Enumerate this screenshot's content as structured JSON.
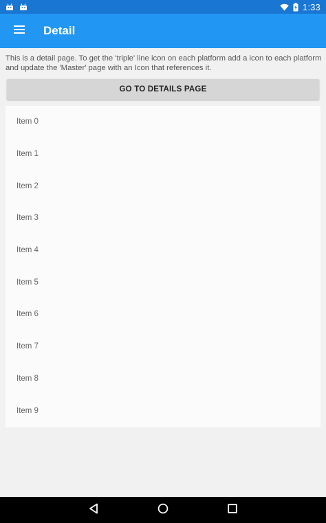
{
  "status_bar": {
    "time": "1:33",
    "left_icons": [
      "android-icon",
      "android-icon"
    ],
    "right_icons": [
      "wifi-icon",
      "battery-charging-icon"
    ]
  },
  "toolbar": {
    "title": "Detail",
    "menu_icon": "hamburger-menu-icon",
    "background": "#2196f3"
  },
  "page": {
    "description": "This is a detail page. To get the 'triple' line icon on each platform add a icon to each platform and update the 'Master' page with an Icon that references it.",
    "button_label": "GO TO DETAILS PAGE"
  },
  "list": {
    "items": [
      "Item 0",
      "Item 1",
      "Item 2",
      "Item 3",
      "Item 4",
      "Item 5",
      "Item 6",
      "Item 7",
      "Item 8",
      "Item 9"
    ]
  },
  "nav_bar": {
    "buttons": [
      "back-icon",
      "home-icon",
      "recents-icon"
    ]
  }
}
